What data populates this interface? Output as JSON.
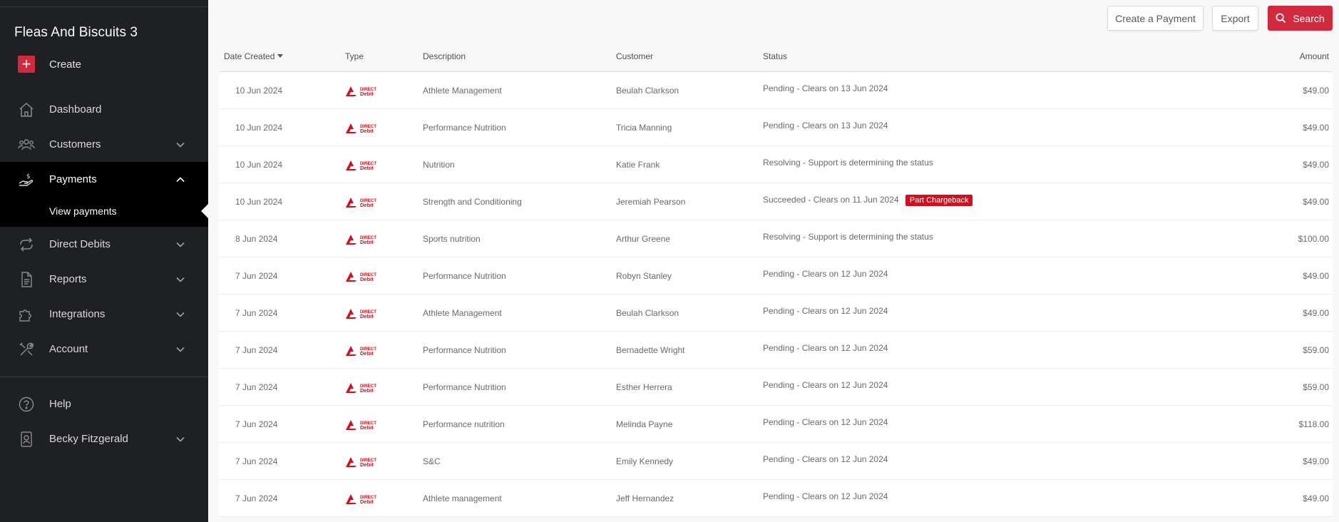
{
  "sidebar": {
    "org_name": "Fleas And Biscuits 3",
    "create_label": "Create",
    "items": [
      {
        "label": "Dashboard",
        "icon": "home-icon"
      },
      {
        "label": "Customers",
        "icon": "users-icon"
      },
      {
        "label": "Payments",
        "icon": "payment-hand-icon"
      },
      {
        "label": "Direct Debits",
        "icon": "repeat-icon"
      },
      {
        "label": "Reports",
        "icon": "document-icon"
      },
      {
        "label": "Integrations",
        "icon": "puzzle-icon"
      },
      {
        "label": "Account",
        "icon": "tools-icon"
      },
      {
        "label": "Help",
        "icon": "help-circle-icon"
      },
      {
        "label": "Becky Fitzgerald",
        "icon": "user-badge-icon"
      }
    ],
    "sub_item_label": "View payments"
  },
  "toolbar": {
    "create_payment_label": "Create a Payment",
    "export_label": "Export",
    "search_label": "Search"
  },
  "table": {
    "headers": {
      "date": "Date Created",
      "type": "Type",
      "description": "Description",
      "customer": "Customer",
      "status": "Status",
      "amount": "Amount"
    },
    "type_logo_text": [
      "DIRECT",
      "Debit"
    ],
    "rows": [
      {
        "date": "10 Jun 2024",
        "description": "Athlete Management",
        "customer": "Beulah Clarkson",
        "status": "Pending - Clears on 13 Jun 2024",
        "badge": "",
        "amount": "$49.00"
      },
      {
        "date": "10 Jun 2024",
        "description": "Performance Nutrition",
        "customer": "Tricia Manning",
        "status": "Pending - Clears on 13 Jun 2024",
        "badge": "",
        "amount": "$49.00"
      },
      {
        "date": "10 Jun 2024",
        "description": "Nutrition",
        "customer": "Katie Frank",
        "status": "Resolving - Support is determining the status",
        "badge": "",
        "amount": "$49.00"
      },
      {
        "date": "10 Jun 2024",
        "description": "Strength and Conditioning",
        "customer": "Jeremiah Pearson",
        "status": "Succeeded - Clears on 11 Jun 2024",
        "badge": "Part Chargeback",
        "amount": "$49.00"
      },
      {
        "date": "8 Jun 2024",
        "description": "Sports nutrition",
        "customer": "Arthur Greene",
        "status": "Resolving - Support is determining the status",
        "badge": "",
        "amount": "$100.00"
      },
      {
        "date": "7 Jun 2024",
        "description": "Performance Nutrition",
        "customer": "Robyn Stanley",
        "status": "Pending - Clears on 12 Jun 2024",
        "badge": "",
        "amount": "$49.00"
      },
      {
        "date": "7 Jun 2024",
        "description": "Athlete Management",
        "customer": "Beulah Clarkson",
        "status": "Pending - Clears on 12 Jun 2024",
        "badge": "",
        "amount": "$49.00"
      },
      {
        "date": "7 Jun 2024",
        "description": "Performance Nutrition",
        "customer": "Bernadette Wright",
        "status": "Pending - Clears on 12 Jun 2024",
        "badge": "",
        "amount": "$59.00"
      },
      {
        "date": "7 Jun 2024",
        "description": "Performance Nutrition",
        "customer": "Esther Herrera",
        "status": "Pending - Clears on 12 Jun 2024",
        "badge": "",
        "amount": "$59.00"
      },
      {
        "date": "7 Jun 2024",
        "description": "Performance nutrition",
        "customer": "Melinda Payne",
        "status": "Pending - Clears on 12 Jun 2024",
        "badge": "",
        "amount": "$118.00"
      },
      {
        "date": "7 Jun 2024",
        "description": "S&C",
        "customer": "Emily Kennedy",
        "status": "Pending - Clears on 12 Jun 2024",
        "badge": "",
        "amount": "$49.00"
      },
      {
        "date": "7 Jun 2024",
        "description": "Athlete management",
        "customer": "Jeff Hernandez",
        "status": "Pending - Clears on 12 Jun 2024",
        "badge": "",
        "amount": "$49.00"
      }
    ]
  },
  "colors": {
    "sidebar_bg": "#1f2024",
    "active_bg": "#000000",
    "accent": "#d1293d",
    "badge": "#d1101f"
  }
}
